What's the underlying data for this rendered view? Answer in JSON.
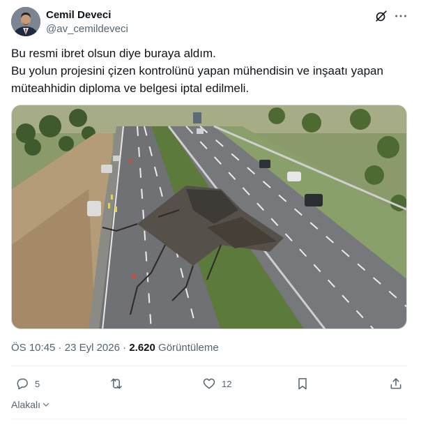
{
  "author": {
    "name": "Cemil Deveci",
    "handle": "@av_cemildeveci"
  },
  "tweet": {
    "line1": "Bu resmi ibret olsun diye buraya aldım.",
    "line2": "Bu yolun projesini çizen kontrolünü yapan mühendisin ve inşaatı yapan müteahhidin diploma ve belgesi iptal edilmeli."
  },
  "meta": {
    "time": "ÖS 10:45",
    "separator1": " · ",
    "date": "23 Eyl 2026",
    "separator2": " · ",
    "views_count": "2.620",
    "views_label": " Görüntüleme"
  },
  "actions": {
    "reply_count": "5",
    "retweet_count": "",
    "like_count": "12"
  },
  "related_label": "Alakalı",
  "icons": {
    "grok": "grok-icon",
    "more": "more-icon",
    "reply": "reply-icon",
    "retweet": "retweet-icon",
    "like": "heart-icon",
    "bookmark": "bookmark-icon",
    "share": "share-icon",
    "chevron": "chevron-down-icon"
  },
  "colors": {
    "text": "#0f1419",
    "secondary": "#536471",
    "border": "#cfd9de"
  }
}
